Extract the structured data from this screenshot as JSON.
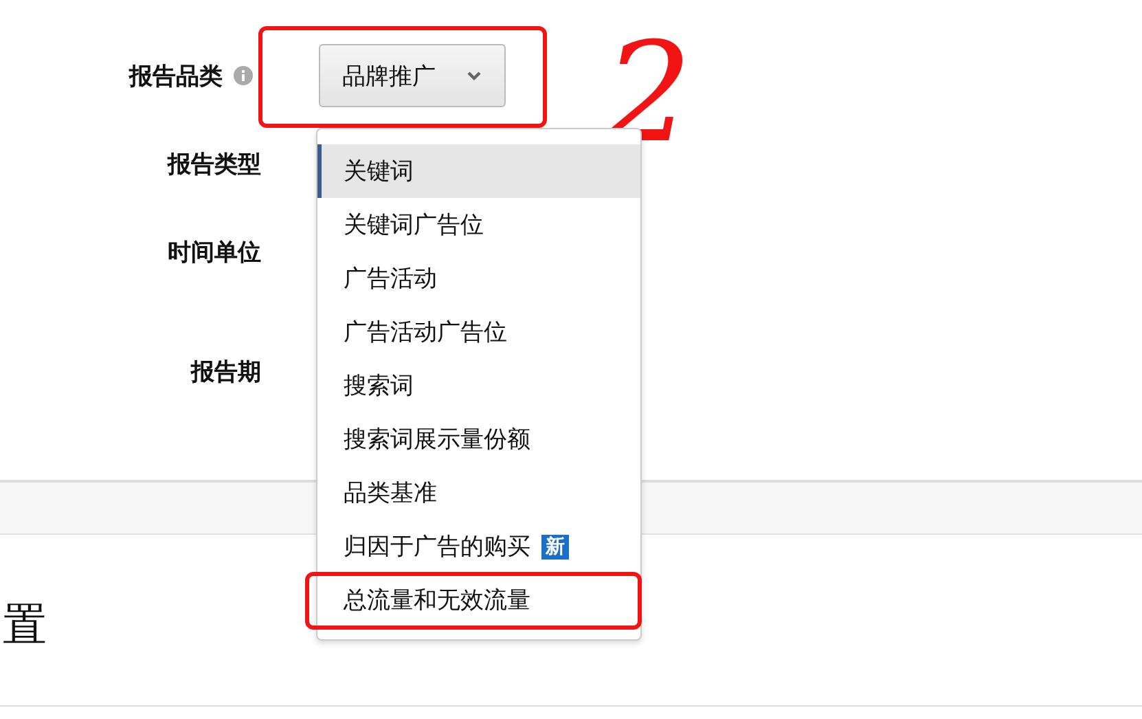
{
  "form": {
    "fields": [
      {
        "label": "报告品类",
        "info": true
      },
      {
        "label": "报告类型",
        "info": false
      },
      {
        "label": "时间单位",
        "info": false
      },
      {
        "label": "报告期",
        "info": false
      }
    ],
    "dropdown": {
      "value": "品牌推广",
      "expanded": true,
      "highlighted": true
    },
    "menu": [
      {
        "label": "关键词",
        "selected": true,
        "highlighted": false
      },
      {
        "label": "关键词广告位",
        "selected": false,
        "highlighted": false
      },
      {
        "label": "广告活动",
        "selected": false,
        "highlighted": false
      },
      {
        "label": "广告活动广告位",
        "selected": false,
        "highlighted": false
      },
      {
        "label": "搜索词",
        "selected": false,
        "highlighted": false
      },
      {
        "label": "搜索词展示量份额",
        "selected": false,
        "highlighted": false
      },
      {
        "label": "品类基准",
        "selected": false,
        "highlighted": false
      },
      {
        "label": "归因于广告的购买",
        "selected": false,
        "highlighted": false,
        "badge": "新"
      },
      {
        "label": "总流量和无效流量",
        "selected": false,
        "highlighted": true
      }
    ]
  },
  "section": {
    "title": "置"
  },
  "annotation": {
    "number": "2"
  }
}
